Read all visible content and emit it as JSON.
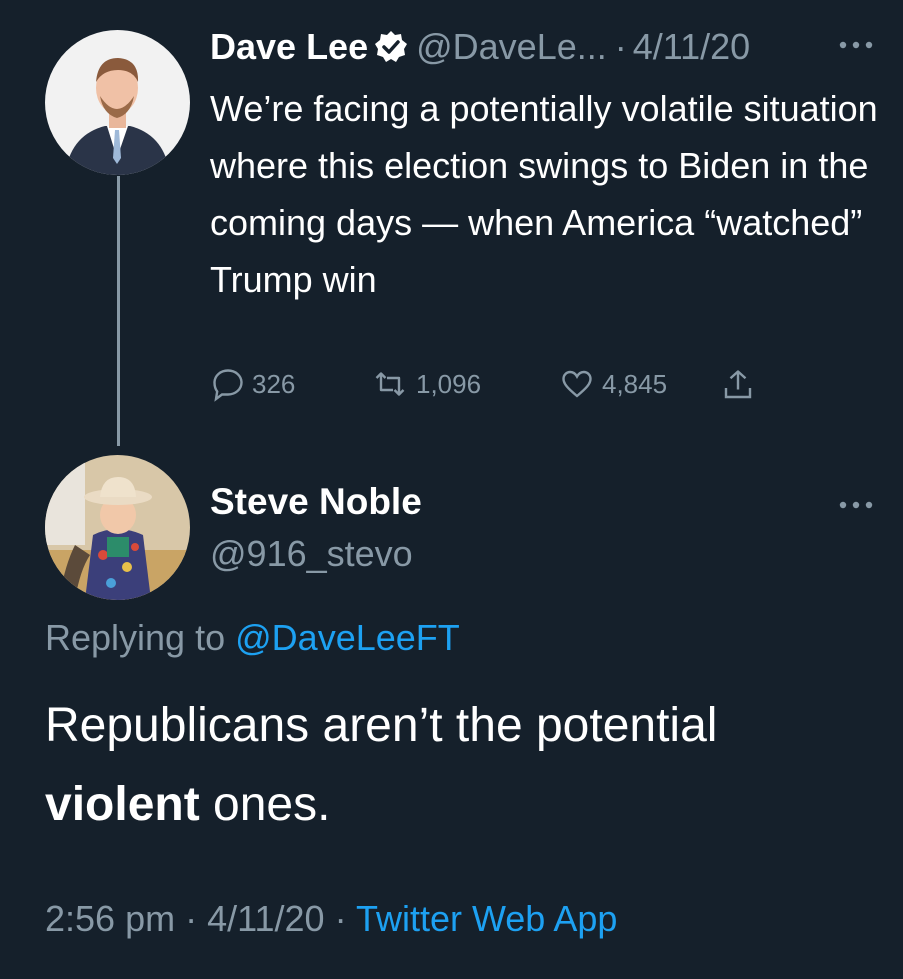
{
  "colors": {
    "background": "#15202b",
    "text_primary": "#ffffff",
    "text_secondary": "#8899a6",
    "link": "#1da1f2"
  },
  "original_tweet": {
    "author_name": "Dave Lee",
    "verified_icon": "verified-badge-icon",
    "handle": "@DaveLe...",
    "separator": "·",
    "date": "4/11/20",
    "more_icon": "more-options-icon",
    "text": "We’re facing a potentially volatile situation where this election swings to Biden in the coming days — when America “watched” Trump win",
    "stats": {
      "replies": "326",
      "retweets": "1,096",
      "likes": "4,845"
    }
  },
  "reply_tweet": {
    "author_name": "Steve Noble",
    "handle": "@916_stevo",
    "more_icon": "more-options-icon",
    "replying_label": "Replying to",
    "replying_to": "@DaveLeeFT",
    "text_part1": "Republicans aren’t the potential ",
    "text_bold": "violent",
    "text_part2": " ones.",
    "time": "2:56 pm",
    "separator": "·",
    "date": "4/11/20",
    "source": "Twitter Web App"
  }
}
